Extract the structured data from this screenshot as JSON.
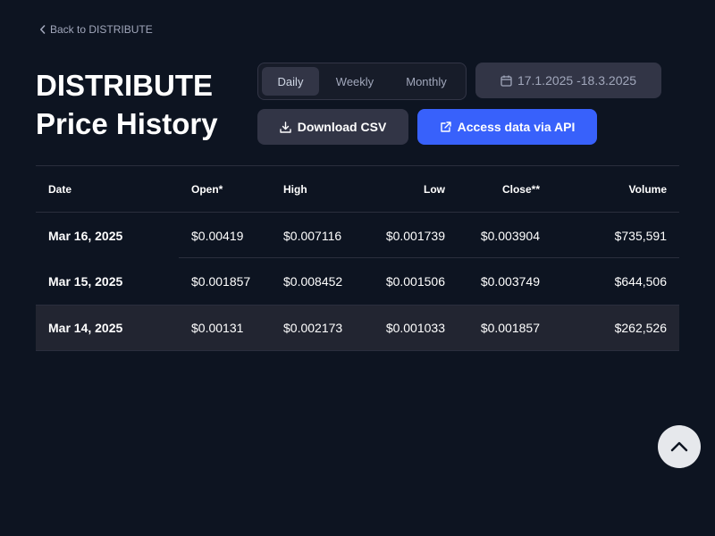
{
  "nav": {
    "back_label": "Back to DISTRIBUTE"
  },
  "header": {
    "title_line1": "DISTRIBUTE",
    "title_line2": "Price History"
  },
  "controls": {
    "intervals": [
      "Daily",
      "Weekly",
      "Monthly"
    ],
    "selected_interval": "Daily",
    "date_range": "17.1.2025 -18.3.2025",
    "download_label": "Download CSV",
    "api_label": "Access data via API"
  },
  "table": {
    "columns": [
      "Date",
      "Open*",
      "High",
      "Low",
      "Close**",
      "Volume"
    ],
    "rows": [
      [
        "Mar 16, 2025",
        "$0.00419",
        "$0.007116",
        "$0.001739",
        "$0.003904",
        "$735,591"
      ],
      [
        "Mar 15, 2025",
        "$0.001857",
        "$0.008452",
        "$0.001506",
        "$0.003749",
        "$644,506"
      ],
      [
        "Mar 14, 2025",
        "$0.00131",
        "$0.002173",
        "$0.001033",
        "$0.001857",
        "$262,526"
      ]
    ]
  },
  "colors": {
    "background": "#0d1421",
    "button_secondary": "#323546",
    "button_primary": "#3861fb",
    "text_muted": "#a1a7bb"
  },
  "icons": {
    "back": "chevron-left-icon",
    "calendar": "calendar-icon",
    "download": "download-icon",
    "api": "external-link-icon",
    "scroll_top": "chevron-up-icon"
  }
}
